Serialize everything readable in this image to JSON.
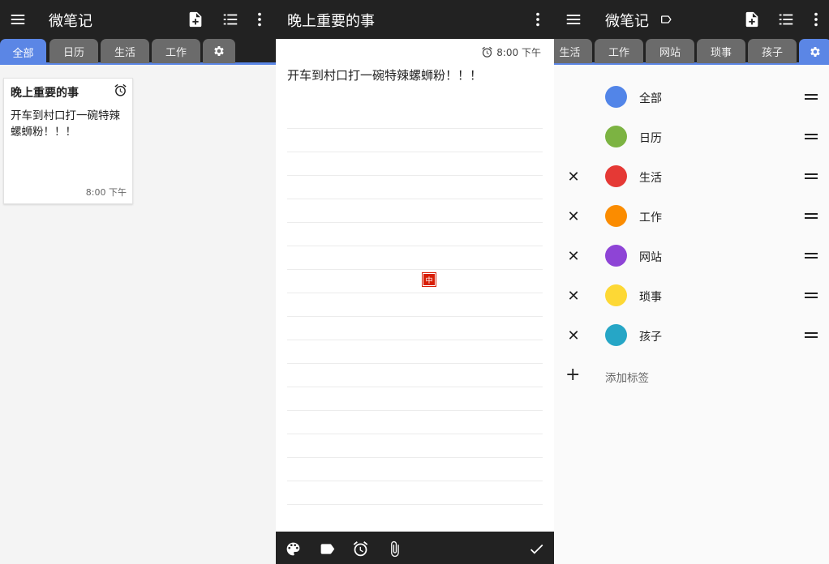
{
  "left": {
    "app_title": "微笔记",
    "tabs": [
      {
        "label": "全部",
        "active": true
      },
      {
        "label": "日历"
      },
      {
        "label": "生活"
      },
      {
        "label": "工作"
      }
    ],
    "note": {
      "title": "晚上重要的事",
      "body": "开车到村口打一碗特辣螺蛳粉！！！",
      "time": "8:00 下午"
    }
  },
  "editor": {
    "title": "晚上重要的事",
    "time": "8:00 下午",
    "text": "开车到村口打一碗特辣螺蛳粉！！！",
    "ime_glyph": "中"
  },
  "right": {
    "app_title": "微笔记",
    "tabs": [
      {
        "label": "生活"
      },
      {
        "label": "工作"
      },
      {
        "label": "网站"
      },
      {
        "label": "琐事"
      },
      {
        "label": "孩子"
      }
    ],
    "tags": [
      {
        "name": "全部",
        "color": "#5285e8",
        "deletable": false
      },
      {
        "name": "日历",
        "color": "#7cb342",
        "deletable": false
      },
      {
        "name": "生活",
        "color": "#e53935",
        "deletable": true
      },
      {
        "name": "工作",
        "color": "#fb8c00",
        "deletable": true
      },
      {
        "name": "网站",
        "color": "#8e44d6",
        "deletable": true
      },
      {
        "name": "琐事",
        "color": "#fdd835",
        "deletable": true
      },
      {
        "name": "孩子",
        "color": "#26a6c6",
        "deletable": true
      }
    ],
    "delete_glyph": "✕",
    "add_glyph": "+",
    "add_label": "添加标签"
  },
  "colors": {
    "appbar": "#222222",
    "accent_tab": "#5b86e5",
    "inactive_tab": "#6b6b6b"
  },
  "icons": [
    "menu-icon",
    "note-add-icon",
    "list-view-icon",
    "more-vert-icon",
    "settings-icon",
    "alarm-icon",
    "label-icon",
    "palette-icon",
    "tag-icon",
    "attach-icon",
    "check-icon"
  ]
}
